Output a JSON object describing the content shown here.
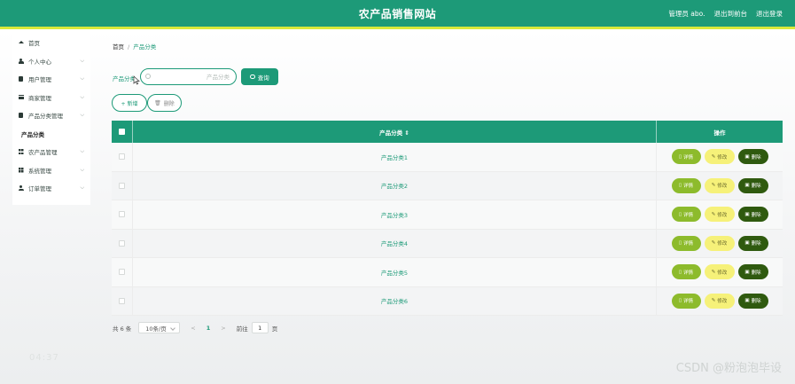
{
  "header": {
    "title": "农产品销售网站",
    "user_label": "管理员 abo.",
    "back_label": "退出到前台",
    "logout_label": "退出登录"
  },
  "sidebar": {
    "items": [
      {
        "label": "首页",
        "icon": "home-icon",
        "has_children": false
      },
      {
        "label": "个人中心",
        "icon": "user-icon",
        "has_children": true
      },
      {
        "label": "用户管理",
        "icon": "box-icon",
        "has_children": true
      },
      {
        "label": "商家管理",
        "icon": "list-icon",
        "has_children": true
      },
      {
        "label": "产品分类管理",
        "icon": "box-icon",
        "has_children": true
      },
      {
        "label": "产品分类",
        "icon": "",
        "has_children": false,
        "sub": true
      },
      {
        "label": "农产品管理",
        "icon": "grid-icon",
        "has_children": true
      },
      {
        "label": "系统管理",
        "icon": "grid-icon",
        "has_children": true
      },
      {
        "label": "订单管理",
        "icon": "user-icon",
        "has_children": true
      }
    ]
  },
  "breadcrumb": {
    "home": "首页",
    "separator": "/",
    "current": "产品分类"
  },
  "search": {
    "label": "产品分类",
    "placeholder": "产品分类",
    "value": "",
    "button_label": "查询"
  },
  "actions": {
    "add_label": "+ 新增",
    "delete_label": "删除"
  },
  "table": {
    "columns": {
      "name": "产品分类 ⇕",
      "operations": "操作"
    },
    "rows": [
      {
        "name": "产品分类1"
      },
      {
        "name": "产品分类2"
      },
      {
        "name": "产品分类3"
      },
      {
        "name": "产品分类4"
      },
      {
        "name": "产品分类5"
      },
      {
        "name": "产品分类6"
      }
    ],
    "row_actions": {
      "detail": "详情",
      "edit": "修改",
      "delete": "删除"
    }
  },
  "pagination": {
    "total_text": "共 6 条",
    "page_size": "10条/页",
    "prev": "<",
    "current_page": "1",
    "next": ">",
    "goto_label": "前往",
    "goto_value": "1",
    "page_unit": "页"
  },
  "overlay": {
    "clock": "04:37",
    "watermark": "CSDN @粉泡泡毕设"
  },
  "colors": {
    "primary": "#1d9a78",
    "accent_line": "#d9e93a",
    "detail_button": "#8dbb2c",
    "edit_button": "#f6f179",
    "delete_button": "#2f5a0f"
  }
}
